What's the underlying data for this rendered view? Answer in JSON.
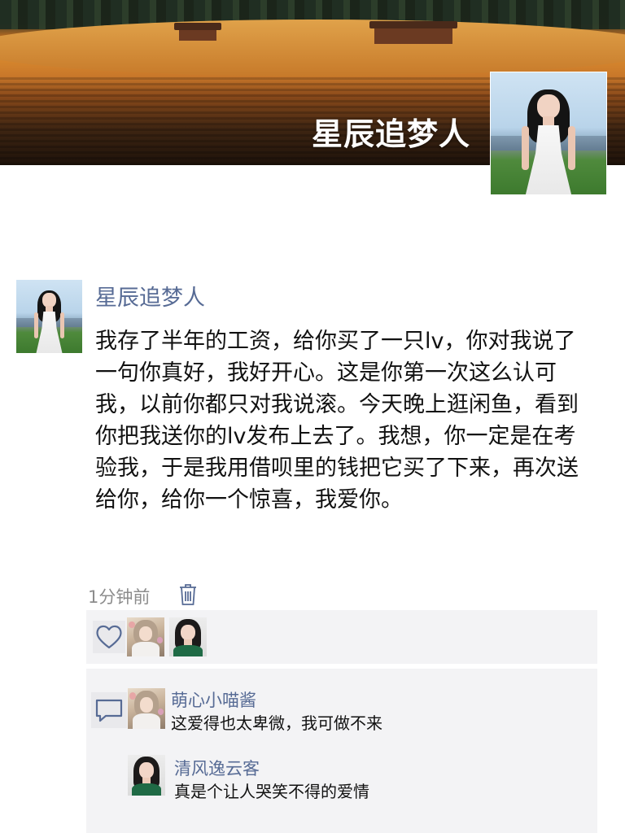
{
  "profile": {
    "nickname": "星辰追梦人"
  },
  "post": {
    "author": "星辰追梦人",
    "text": "我存了半年的工资，给你买了一只lv，你对我说了一句你真好，我好开心。这是你第一次这么认可我，以前你都只对我说滚。今天晚上逛闲鱼，看到你把我送你的lv发布上去了。我想，你一定是在考验我，于是我用借呗里的钱把它买了下来，再次送给你，给你一个惊喜，我爱你。",
    "time": "1分钟前"
  },
  "icons": {
    "delete": "trash-icon",
    "like": "heart-icon",
    "comment": "comment-bubble-icon"
  },
  "colors": {
    "link": "#576b95",
    "panel": "#f3f3f5",
    "time": "#8c8c8c"
  },
  "comments": [
    {
      "author": "萌心小喵酱",
      "text": "这爱得也太卑微，我可做不来"
    },
    {
      "author": "清风逸云客",
      "text": "真是个让人哭笑不得的爱情"
    }
  ]
}
